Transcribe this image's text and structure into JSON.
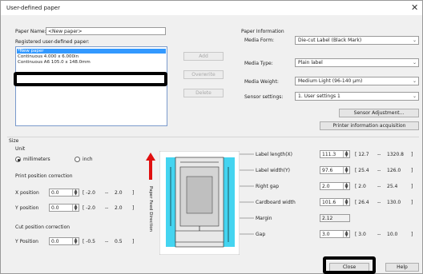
{
  "window": {
    "title": "User-defined paper",
    "close_glyph": "✕"
  },
  "paper_name": {
    "label": "Paper Name:",
    "value": "<New paper>"
  },
  "registered": {
    "label": "Registered user-defined paper:",
    "items": [
      "*New paper",
      "Continuous 4.000 x 6.000in",
      "Continuous A6 105.0 x 148.0mm"
    ]
  },
  "list_buttons": {
    "add": "Add",
    "overwrite": "Overwrite",
    "delete": "Delete"
  },
  "paper_info": {
    "heading": "Paper Information",
    "media_form": {
      "label": "Media Form:",
      "value": "Die-cut Label (Black Mark)"
    },
    "media_type": {
      "label": "Media Type:",
      "value": "Plain label"
    },
    "media_weight": {
      "label": "Media Weight:",
      "value": "Medium Light (96-140 µm)"
    },
    "sensor": {
      "label": "Sensor settings:",
      "value": "1. User settings 1"
    },
    "sensor_adjust": "Sensor Adjustment...",
    "printer_info": "Printer information acquisition"
  },
  "size": {
    "heading": "Size",
    "unit_label": "Unit",
    "mm": "millimeters",
    "inch": "inch"
  },
  "print_pos": {
    "heading": "Print position correction",
    "x": {
      "label": "X position",
      "value": "0.0",
      "range_open": "[ -2.0",
      "dash": "--",
      "max": "2.0",
      "range_close": "]"
    },
    "y": {
      "label": "Y position",
      "value": "0.0",
      "range_open": "[ -2.0",
      "dash": "--",
      "max": "2.0",
      "range_close": "]"
    }
  },
  "cut_pos": {
    "heading": "Cut position correction",
    "y": {
      "label": "Y Position",
      "value": "0.0",
      "range_open": "[ -0.5",
      "dash": "--",
      "max": "0.5",
      "range_close": "]"
    }
  },
  "feed_label": "Paper Feed Direction",
  "dims": [
    {
      "label": "Label length(X)",
      "value": "111.3",
      "min": "[ 12.7",
      "dash": "--",
      "max": "1320.8",
      "close": "]"
    },
    {
      "label": "Label width(Y)",
      "value": "97.6",
      "min": "[ 25.4",
      "dash": "--",
      "max": "126.0",
      "close": "]"
    },
    {
      "label": "Right gap",
      "value": "2.0",
      "min": "[ 2.0",
      "dash": "--",
      "max": "25.4",
      "close": "]"
    },
    {
      "label": "Cardboard width",
      "value": "101.6",
      "min": "[ 26.4",
      "dash": "--",
      "max": "130.0",
      "close": "]"
    },
    {
      "label": "Margin",
      "value": "2.12",
      "min": "",
      "dash": "",
      "max": "",
      "close": ""
    },
    {
      "label": "Gap",
      "value": "3.0",
      "min": "[ 3.0",
      "dash": "--",
      "max": "10.0",
      "close": "]"
    }
  ],
  "footer": {
    "close": "Close",
    "help": "Help"
  },
  "colors": {
    "diagram_bg": "#44d4f0",
    "selection": "#3399ff",
    "arrow": "#e01010"
  }
}
